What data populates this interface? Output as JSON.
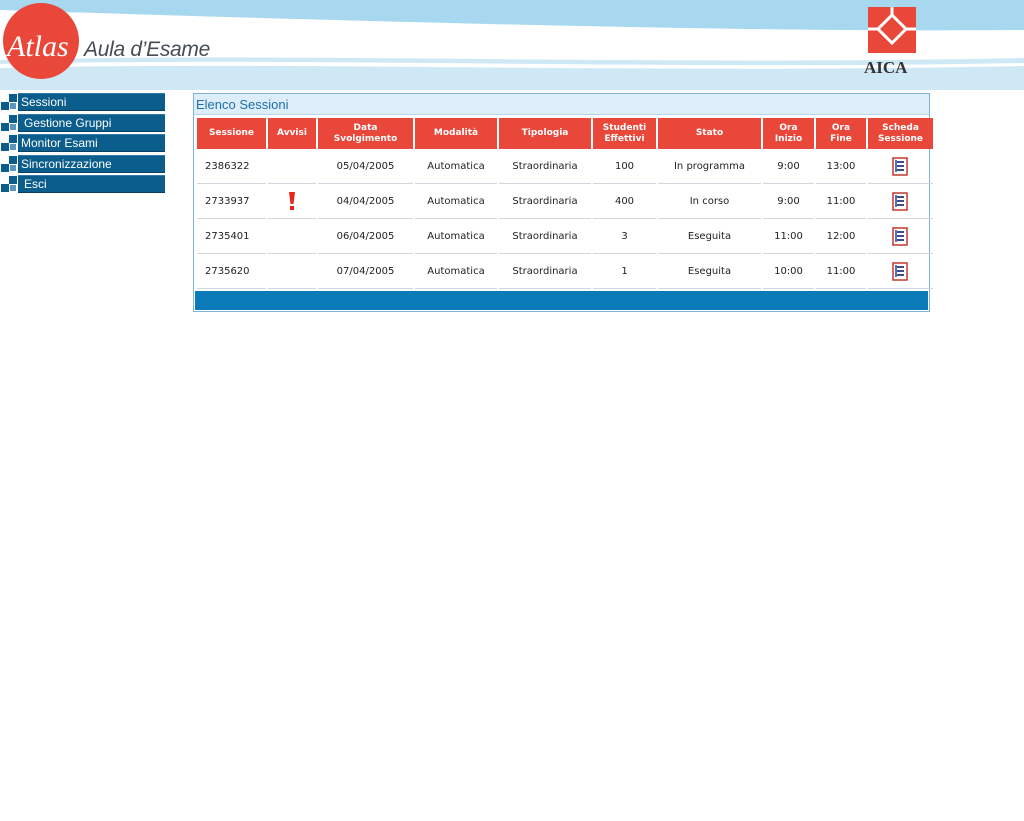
{
  "header": {
    "logo_text": "Atlas",
    "subtitle": "Aula d’Esame",
    "partner_logo_text": "AICA"
  },
  "sidebar": {
    "items": [
      {
        "label": "Sessioni"
      },
      {
        "label": "Gestione Gruppi"
      },
      {
        "label": "Monitor Esami"
      },
      {
        "label": "Sincronizzazione"
      },
      {
        "label": "Esci"
      }
    ]
  },
  "panel": {
    "title": "Elenco Sessioni"
  },
  "table": {
    "columns": [
      "Sessione",
      "Avvisi",
      "Data\nSvolgimento",
      "Modalità",
      "Tipologia",
      "Studenti\nEffettivi",
      "Stato",
      "Ora\nInizio",
      "Ora\nFine",
      "Scheda\nSessione"
    ],
    "rows": [
      {
        "sessione": "2386322",
        "avviso": false,
        "data": "05/04/2005",
        "modalita": "Automatica",
        "tipologia": "Straordinaria",
        "studenti": "100",
        "stato": "In programma",
        "ora_inizio": "9:00",
        "ora_fine": "13:00",
        "scheda_icon": "document-icon"
      },
      {
        "sessione": "2733937",
        "avviso": true,
        "avviso_icon": "exclamation-icon",
        "data": "04/04/2005",
        "modalita": "Automatica",
        "tipologia": "Straordinaria",
        "studenti": "400",
        "stato": "In corso",
        "ora_inizio": "9:00",
        "ora_fine": "11:00",
        "scheda_icon": "document-icon"
      },
      {
        "sessione": "2735401",
        "avviso": false,
        "data": "06/04/2005",
        "modalita": "Automatica",
        "tipologia": "Straordinaria",
        "studenti": "3",
        "stato": "Eseguita",
        "ora_inizio": "11:00",
        "ora_fine": "12:00",
        "scheda_icon": "document-icon"
      },
      {
        "sessione": "2735620",
        "avviso": false,
        "data": "07/04/2005",
        "modalita": "Automatica",
        "tipologia": "Straordinaria",
        "studenti": "1",
        "stato": "Eseguita",
        "ora_inizio": "10:00",
        "ora_fine": "11:00",
        "scheda_icon": "document-icon"
      }
    ]
  },
  "colors": {
    "brand_red": "#e8473a",
    "nav_blue": "#0b5d8c",
    "footer_blue": "#0a7bb8",
    "title_blue": "#1d6fa8",
    "header_sky": "#a8d8ef"
  }
}
